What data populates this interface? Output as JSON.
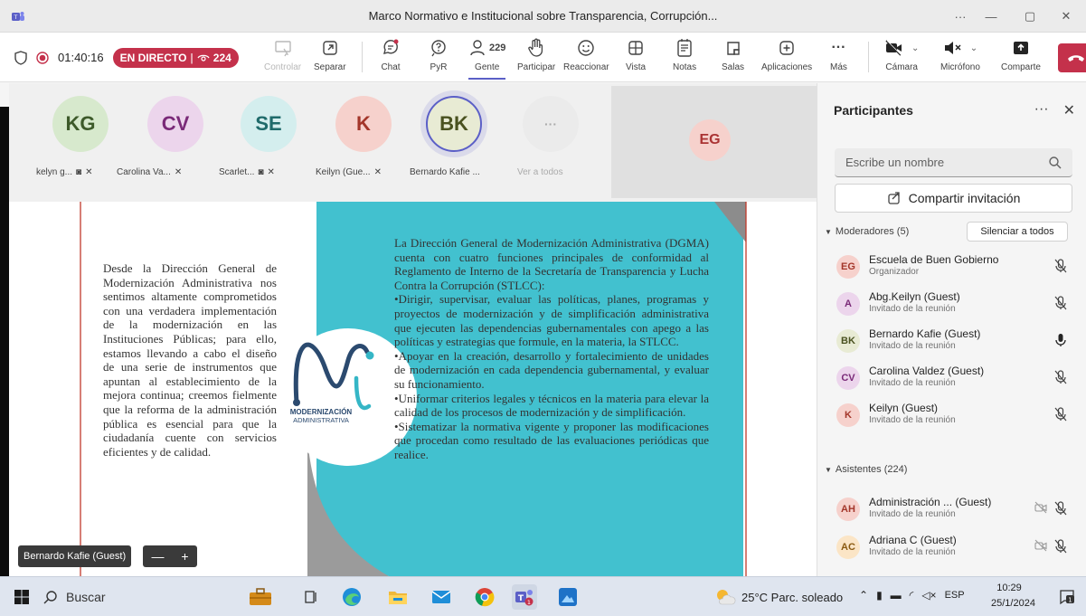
{
  "window": {
    "title": "Marco Normativo e Institucional sobre Transparencia, Corrupción...",
    "controls": {
      "more": "···",
      "minimize": "—",
      "maximize": "▢",
      "close": "✕"
    }
  },
  "toolbar": {
    "timer": "01:40:16",
    "live_label": "EN DIRECTO",
    "live_viewers": "224",
    "items": {
      "controlar": "Controlar",
      "separar": "Separar",
      "chat": "Chat",
      "pyr": "PyR",
      "gente": "Gente",
      "gente_count": "229",
      "participar": "Participar",
      "reaccionar": "Reaccionar",
      "vista": "Vista",
      "notas": "Notas",
      "salas": "Salas",
      "aplicaciones": "Aplicaciones",
      "mas": "Más",
      "camara": "Cámara",
      "microfono": "Micrófono",
      "comparte": "Comparte"
    }
  },
  "gallery": {
    "tiles": [
      {
        "initials": "KG",
        "name": "kelyn g...",
        "color": "#d7e9cd",
        "text_color": "#3d5a2a"
      },
      {
        "initials": "CV",
        "name": "Carolina Va...",
        "color": "#ecd5ec",
        "text_color": "#7a2a78"
      },
      {
        "initials": "SE",
        "name": "Scarlet...",
        "color": "#d4eeee",
        "text_color": "#1f6b6b"
      },
      {
        "initials": "K",
        "name": "Keilyn (Gue...",
        "color": "#f6d1cc",
        "text_color": "#a3362a"
      },
      {
        "initials": "BK",
        "name": "Bernardo Kafie ...",
        "color": "#e8ebd4",
        "text_color": "#4a5220"
      },
      {
        "initials": "···",
        "name": "Ver a todos",
        "color": "#ebebeb",
        "text_color": "#999"
      }
    ],
    "speaker_tile": {
      "initials": "EG"
    }
  },
  "slide": {
    "left_text": "Desde la Dirección General de Modernización Administrativa nos sentimos altamente comprometidos con una verdadera implementación de la modernización en las Instituciones Públicas; para ello, estamos llevando a cabo el diseño de una serie de instrumentos que apuntan al establecimiento de la mejora continua; creemos fielmente que la reforma de la administración pública es esencial para que la ciudadanía cuente con servicios eficientes y de calidad.",
    "right_paragraphs": [
      "La Dirección General de Modernización Administrativa (DGMA) cuenta con cuatro funciones principales de conformidad al Reglamento de Interno de la Secretaría de Transparencia y Lucha Contra la Corrupción (STLCC):",
      "•Dirigir, supervisar, evaluar las políticas, planes, programas y proyectos de modernización y de simplificación administrativa que ejecuten las dependencias gubernamentales con apego a las políticas y estrategias que formule, en la materia, la STLCC.",
      "•Apoyar en la creación, desarrollo y fortalecimiento de unidades de modernización en cada dependencia gubernamental, y evaluar su funcionamiento.",
      "•Uniformar criterios legales y técnicos en la materia para elevar la calidad de los procesos de modernización y de simplificación.",
      "•Sistematizar la normativa vigente y proponer las modificaciones que procedan como resultado de las evaluaciones periódicas que realice."
    ],
    "logo_line1": "MODERNIZACIÓN",
    "logo_line2": "ADMINISTRATIVA",
    "presenter_tag": "Bernardo Kafie (Guest)",
    "zoom_minus": "—",
    "zoom_plus": "+",
    "colors": {
      "teal": "#45c1cf",
      "red_line": "#c0392b"
    }
  },
  "panel": {
    "title": "Participantes",
    "search_placeholder": "Escribe un nombre",
    "invite_label": "Compartir invitación",
    "moderators_header": "Moderadores (5)",
    "mute_all": "Silenciar a todos",
    "moderators": [
      {
        "initials": "EG",
        "name": "Escuela de Buen Gobierno",
        "role": "Organizador",
        "color": "#f6d1cc",
        "text_color": "#a3362a",
        "mic": "muted"
      },
      {
        "initials": "A",
        "name": "Abg.Keilyn (Guest)",
        "role": "Invitado de la reunión",
        "color": "#ecd5ec",
        "text_color": "#7a2a78",
        "mic": "muted"
      },
      {
        "initials": "BK",
        "name": "Bernardo Kafie (Guest)",
        "role": "Invitado de la reunión",
        "color": "#e8ebd4",
        "text_color": "#4a5220",
        "mic": "on"
      },
      {
        "initials": "CV",
        "name": "Carolina Valdez (Guest)",
        "role": "Invitado de la reunión",
        "color": "#ecd5ec",
        "text_color": "#7a2a78",
        "mic": "muted"
      },
      {
        "initials": "K",
        "name": "Keilyn (Guest)",
        "role": "Invitado de la reunión",
        "color": "#f6d1cc",
        "text_color": "#a3362a",
        "mic": "muted"
      }
    ],
    "attendees_header": "Asistentes (224)",
    "attendees": [
      {
        "initials": "AH",
        "name": "Administración ...  (Guest)",
        "role": "Invitado de la reunión",
        "color": "#f6d1cc",
        "text_color": "#a3362a"
      },
      {
        "initials": "AC",
        "name": "Adriana C (Guest)",
        "role": "Invitado de la reunión",
        "color": "#fbe5c6",
        "text_color": "#8a5a12"
      }
    ]
  },
  "taskbar": {
    "search": "Buscar",
    "weather": "25°C  Parc. soleado",
    "lang": "ESP",
    "time": "10:29",
    "date": "25/1/2024",
    "notif_count": "1"
  }
}
